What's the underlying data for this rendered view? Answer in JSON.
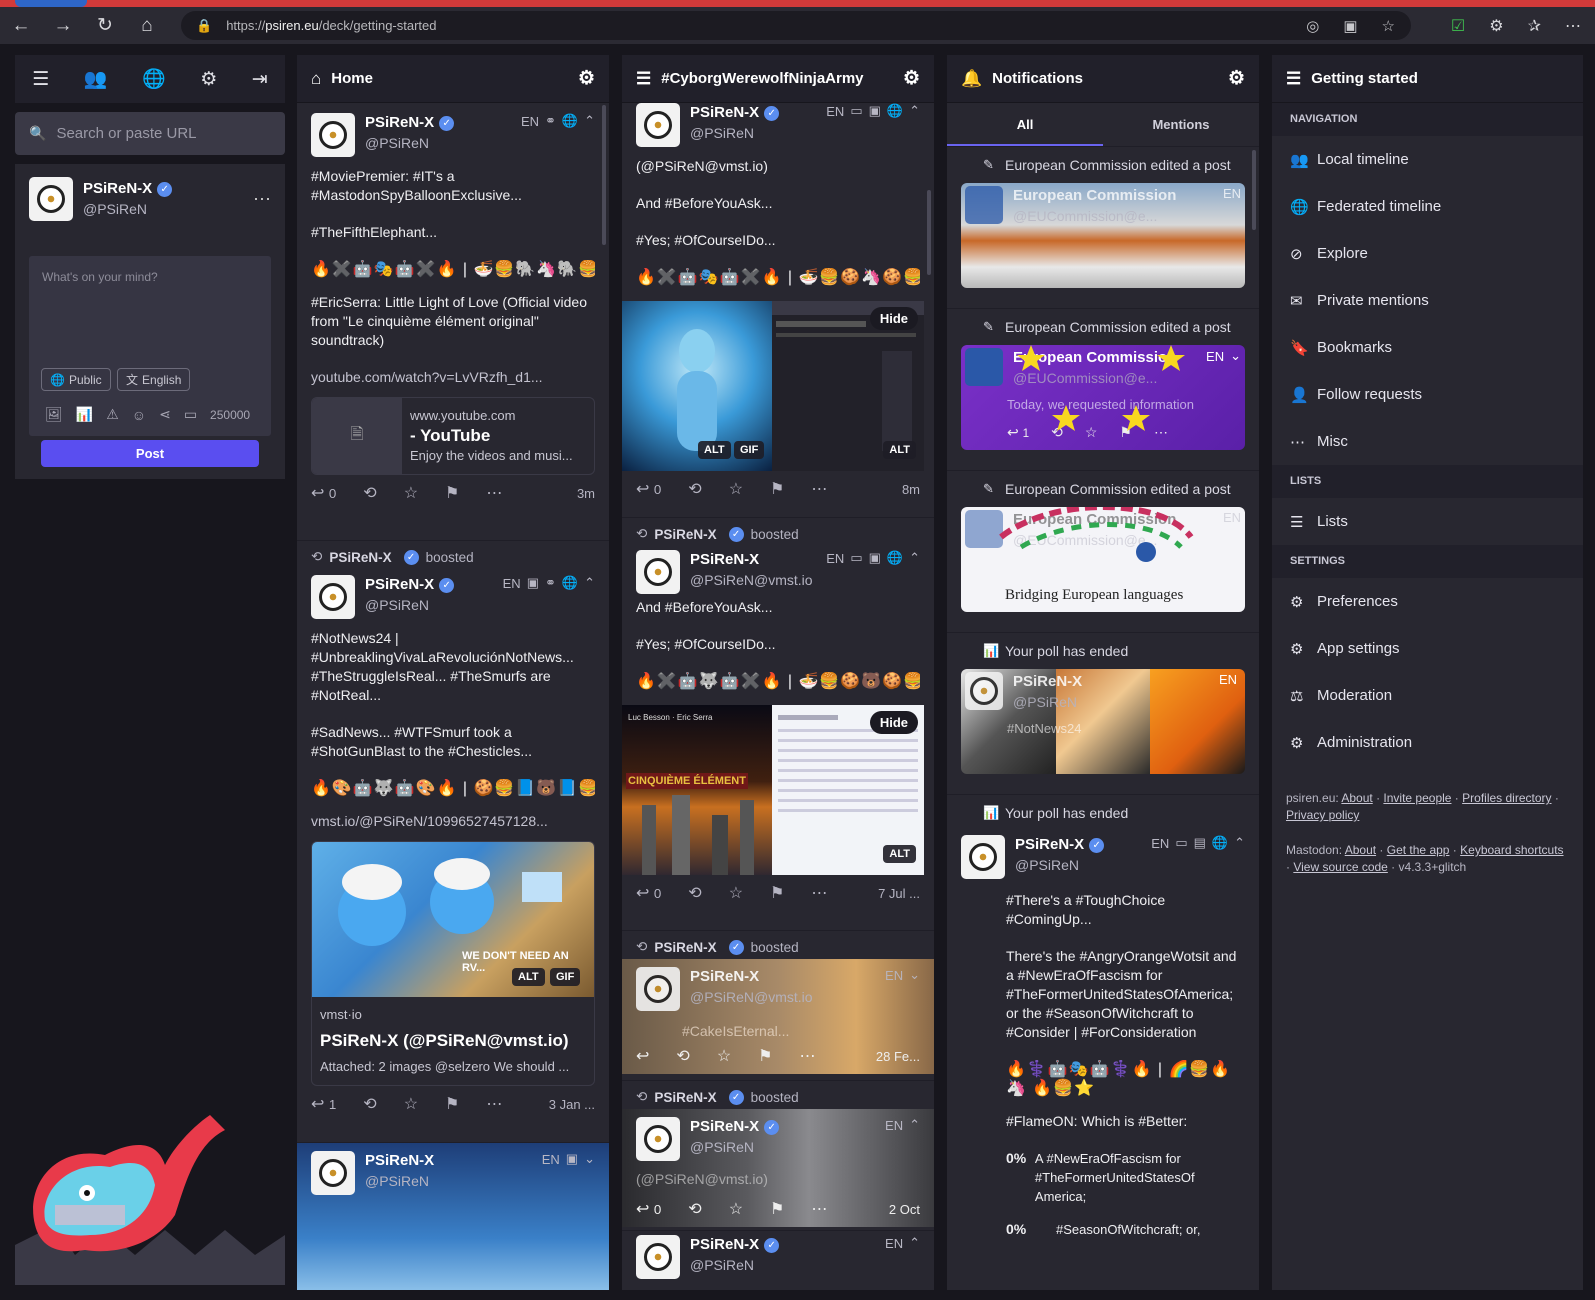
{
  "browser": {
    "url": "https://psiren.eu/deck/getting-started",
    "url_host": "psiren.eu",
    "url_prefix": "https://",
    "url_path": "/deck/getting-started"
  },
  "sidebar": {
    "search_placeholder": "Search or paste URL",
    "user": {
      "name": "PSiReN-X",
      "handle": "@PSiReN"
    },
    "compose_placeholder": "What's on your mind?",
    "visibility": "Public",
    "language": "English",
    "char_count": "250000",
    "post_label": "Post"
  },
  "home": {
    "title": "Home",
    "posts": [
      {
        "name": "PSiReN-X",
        "handle": "@PSiReN",
        "lang": "EN",
        "text1": "#MoviePremier: #IT's a #MastodonSpyBalloonExclusive...",
        "text2": "#TheFifthElephant...",
        "emoji": "🔥✖️🤖🎭🤖✖️🔥 | 🍜🍔🐘🦄🐘🍔🍜",
        "text3": "#EricSerra: Little Light of Love (Official video from \"Le cinquième élément original\" soundtrack)",
        "link": "youtube.com/watch?v=LvVRzfh_d1...",
        "card_domain": "www.youtube.com",
        "card_title": "- YouTube",
        "card_desc": "Enjoy the videos and musi...",
        "replies": "0",
        "time": "3m"
      },
      {
        "booster": "PSiReN-X",
        "boosted": "boosted",
        "name": "PSiReN-X",
        "handle": "@PSiReN",
        "lang": "EN",
        "text1": "#NotNews24 | #UnbreaklingVivaLaRevoluciónNotNews... #TheStruggleIsReal... #TheSmurfs are #NotReal...",
        "text2": "#SadNews... #WTFSmurf took a #ShotGunBlast to the #Chesticles...",
        "emoji": "🔥🎨🤖🐺🤖🎨🔥 | 🍪🍔📘🐻📘🍔🍪",
        "link": "vmst.io/@PSiReN/10996527457128...",
        "img_text": "WE DON'T NEED AN RV...",
        "card_domain": "vmst·io",
        "card_title": "PSiReN-X (@PSiReN@vmst.io)",
        "card_desc": "Attached: 2 images @selzero We should ...",
        "replies": "1",
        "time": "3 Jan ..."
      },
      {
        "name": "PSiReN-X",
        "handle": "@PSiReN",
        "lang": "EN"
      }
    ]
  },
  "hashtag": {
    "title": "#CyborgWerewolfNinjaArmy",
    "posts": [
      {
        "name": "PSiReN-X",
        "handle": "@PSiReN",
        "lang": "EN",
        "text0": "(@PSiReN@vmst.io)",
        "text1": "And #BeforeYouAsk...",
        "text2": "#Yes; #OfCourseIDo...",
        "emoji": "🔥✖️🤖🎭🤖✖️🔥 | 🍜🍔🍪🦄🍪🍔🍜",
        "hide": "Hide",
        "alt": "ALT",
        "gif": "GIF",
        "replies": "0",
        "time": "8m"
      },
      {
        "booster": "PSiReN-X",
        "boosted": "boosted",
        "name": "PSiReN-X",
        "handle": "@PSiReN@vmst.io",
        "lang": "EN",
        "text1": "And #BeforeYouAsk...",
        "text2": "#Yes; #OfCourseIDo...",
        "emoji": "🔥✖️🤖🐺🤖✖️🔥 | 🍜🍔🍪🐻🍪🍔🍜",
        "poster_title": "CINQUIÈME ÉLÉMENT",
        "poster_names": "Luc Besson · Eric Serra",
        "hide": "Hide",
        "alt": "ALT",
        "replies": "0",
        "time": "7 Jul ..."
      },
      {
        "booster": "PSiReN-X",
        "boosted": "boosted",
        "name": "PSiReN-X",
        "handle": "@PSiReN@vmst.io",
        "lang": "EN",
        "overlay": "#CakeIsEternal...",
        "replies": "",
        "time": "28 Fe..."
      },
      {
        "booster": "PSiReN-X",
        "boosted": "boosted",
        "name": "PSiReN-X",
        "handle": "@PSiReN",
        "lang": "EN",
        "overlay": "(@PSiReN@vmst.io)",
        "replies": "0",
        "time": "2 Oct"
      },
      {
        "name": "PSiReN-X",
        "handle": "@PSiReN",
        "lang": "EN"
      }
    ]
  },
  "notifications": {
    "title": "Notifications",
    "tab_all": "All",
    "tab_mentions": "Mentions",
    "items": [
      {
        "label": "European Commission edited a post",
        "name": "European Commission",
        "handle": "@EUCommission@e...",
        "lang": "EN"
      },
      {
        "label": "European Commission edited a post",
        "name": "European Commission",
        "handle": "@EUCommission@e...",
        "text": "Today, we requested information",
        "lang": "EN",
        "replies": "1"
      },
      {
        "label": "European Commission edited a post",
        "name": "European Commission",
        "handle": "@EUCommission@e...",
        "text": "Bridging European languages",
        "lang": "EN"
      },
      {
        "label": "Your poll has ended",
        "name": "PSiReN-X",
        "handle": "@PSiReN",
        "overlay": "#NotNews24",
        "lang": "EN"
      },
      {
        "label": "Your poll has ended",
        "name": "PSiReN-X",
        "handle": "@PSiReN",
        "lang": "EN",
        "text1": "#There's a #ToughChoice #ComingUp...",
        "text2": "There's the #AngryOrangeWotsit and a #NewEraOfFascism for #TheFormerUnitedStatesOfAmerica; or the #SeasonOfWitchcraft to #Consider | #ForConsideration",
        "emoji": "🔥⚕️🤖🎭🤖⚕️🔥 | 🌈🍔🔥🦄 🔥🍔⭐",
        "text3": "#FlameON: Which is #Better:",
        "poll": [
          {
            "pct": "0%",
            "text": "A #NewEraOfFascism for #TheFormerUnitedStatesOf America;"
          },
          {
            "pct": "0%",
            "text": "#SeasonOfWitchcraft; or,"
          }
        ]
      }
    ]
  },
  "getting_started": {
    "title": "Getting started",
    "nav_heading": "NAVIGATION",
    "nav": [
      "Local timeline",
      "Federated timeline",
      "Explore",
      "Private mentions",
      "Bookmarks",
      "Follow requests",
      "Misc"
    ],
    "lists_heading": "LISTS",
    "lists": [
      "Lists"
    ],
    "settings_heading": "SETTINGS",
    "settings": [
      "Preferences",
      "App settings",
      "Moderation",
      "Administration"
    ],
    "footer": {
      "site": "psiren.eu:",
      "about": "About",
      "invite": "Invite people",
      "profiles": "Profiles directory",
      "privacy": "Privacy policy",
      "mastodon": "Mastodon:",
      "about2": "About",
      "getapp": "Get the app",
      "keyboard": "Keyboard shortcuts",
      "source": "View source code",
      "version": "v4.3.3+glitch"
    }
  },
  "colors": {
    "accent": "#5a4ef0",
    "column": "#282730",
    "background": "#17161d",
    "verified": "#5b8ef0"
  }
}
